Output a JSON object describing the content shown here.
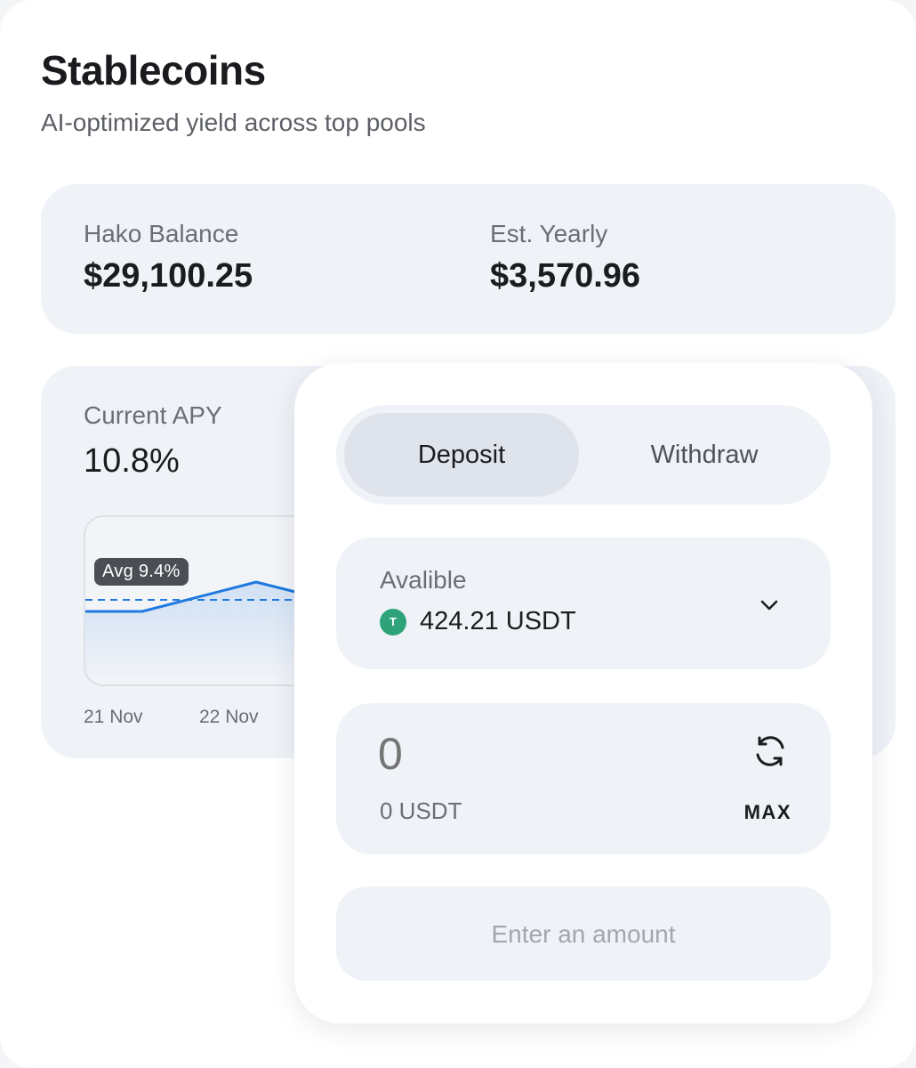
{
  "header": {
    "title": "Stablecoins",
    "subtitle": "AI-optimized yield across top pools"
  },
  "balance": {
    "hako_label": "Hako Balance",
    "hako_value": "$29,100.25",
    "yearly_label": "Est. Yearly",
    "yearly_value": "$3,570.96"
  },
  "apy": {
    "label": "Current APY",
    "value": "10.8%",
    "avg_badge": "Avg 9.4%",
    "x_ticks": [
      "21 Nov",
      "22 Nov"
    ]
  },
  "panel": {
    "tabs": {
      "deposit": "Deposit",
      "withdraw": "Withdraw",
      "active": "deposit"
    },
    "available": {
      "label": "Avalible",
      "token_symbol_glyph": "T",
      "amount": "424.21 USDT",
      "token_icon": "tether-icon"
    },
    "amount": {
      "value": "0",
      "sub": "0 USDT",
      "max_label": "MAX"
    },
    "submit_label": "Enter an amount"
  },
  "colors": {
    "accent_line": "#1f7ae0",
    "token_green": "#2ea37a",
    "card_bg": "#eff2f7"
  }
}
